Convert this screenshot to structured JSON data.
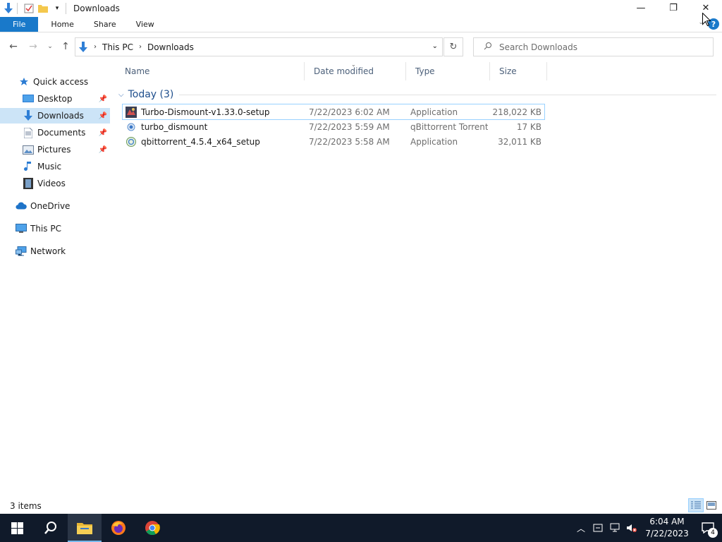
{
  "window": {
    "title": "Downloads",
    "controls": {
      "minimize": "—",
      "maximize": "❐",
      "close": "✕"
    }
  },
  "ribbon": {
    "tabs": [
      "File",
      "Home",
      "Share",
      "View"
    ],
    "help": "?"
  },
  "address": {
    "crumbs": [
      "This PC",
      "Downloads"
    ],
    "search_placeholder": "Search Downloads"
  },
  "nav": {
    "items": [
      {
        "label": "Quick access",
        "icon": "star-icon",
        "pinned": false
      },
      {
        "label": "Desktop",
        "icon": "desktop-folder-icon",
        "pinned": true
      },
      {
        "label": "Downloads",
        "icon": "download-arrow-icon",
        "pinned": true,
        "selected": true
      },
      {
        "label": "Documents",
        "icon": "document-icon",
        "pinned": true
      },
      {
        "label": "Pictures",
        "icon": "pictures-icon",
        "pinned": true
      },
      {
        "label": "Music",
        "icon": "music-note-icon",
        "pinned": false
      },
      {
        "label": "Videos",
        "icon": "film-icon",
        "pinned": false
      },
      {
        "label": "OneDrive",
        "icon": "cloud-icon",
        "pinned": false
      },
      {
        "label": "This PC",
        "icon": "monitor-icon",
        "pinned": false
      },
      {
        "label": "Network",
        "icon": "network-icon",
        "pinned": false
      }
    ]
  },
  "columns": {
    "name": "Name",
    "date": "Date modified",
    "type": "Type",
    "size": "Size"
  },
  "group": {
    "title": "Today (3)"
  },
  "files": [
    {
      "name": "Turbo-Dismount-v1.33.0-setup",
      "date": "7/22/2023 6:02 AM",
      "type": "Application",
      "size": "218,022 KB",
      "icon": "app-game-icon",
      "selected": true
    },
    {
      "name": "turbo_dismount",
      "date": "7/22/2023 5:59 AM",
      "type": "qBittorrent Torrent...",
      "size": "17 KB",
      "icon": "torrent-file-icon",
      "selected": false
    },
    {
      "name": "qbittorrent_4.5.4_x64_setup",
      "date": "7/22/2023 5:58 AM",
      "type": "Application",
      "size": "32,011 KB",
      "icon": "installer-icon",
      "selected": false
    }
  ],
  "status": {
    "items": "3 items"
  },
  "taskbar": {
    "clock_time": "6:04 AM",
    "clock_date": "7/22/2023",
    "notifications": "4"
  },
  "colors": {
    "accent": "#1979ca",
    "selection": "#cce4f7",
    "taskbar": "#101a2a"
  }
}
